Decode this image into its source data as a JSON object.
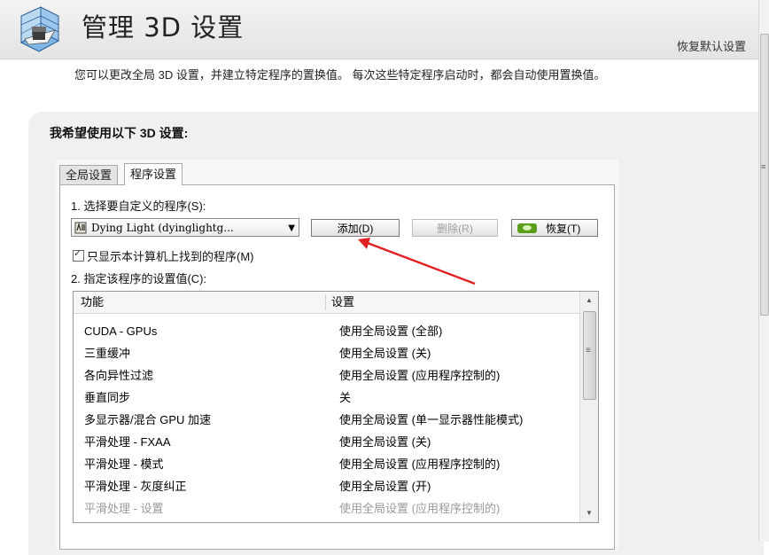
{
  "header": {
    "title": "管理 3D 设置",
    "restore_defaults": "恢复默认设置",
    "app_icon": "nvidia-3d-settings-icon"
  },
  "description": "您可以更改全局 3D 设置，并建立特定程序的置换值。 每次这些特定程序启动时，都会自动使用置换值。",
  "section_title": "我希望使用以下 3D 设置:",
  "tabs": [
    {
      "label": "全局设置",
      "active": false
    },
    {
      "label": "程序设置",
      "active": true
    }
  ],
  "program_settings": {
    "step1_label": "1. 选择要自定义的程序(S):",
    "selected_program": "Dying Light (dyinglightg...",
    "buttons": {
      "add": "添加(D)",
      "remove": "删除(R)",
      "restore": "恢复(T)"
    },
    "show_only_found": "只显示本计算机上找到的程序(M)",
    "show_only_found_checked": true,
    "step2_label": "2. 指定该程序的设置值(C):",
    "columns": [
      "功能",
      "设置"
    ],
    "rows": [
      {
        "feature": "CUDA - GPUs",
        "setting": "使用全局设置 (全部)"
      },
      {
        "feature": "三重缓冲",
        "setting": "使用全局设置 (关)"
      },
      {
        "feature": "各向异性过滤",
        "setting": "使用全局设置 (应用程序控制的)"
      },
      {
        "feature": "垂直同步",
        "setting": "关"
      },
      {
        "feature": "多显示器/混合 GPU 加速",
        "setting": "使用全局设置 (单一显示器性能模式)"
      },
      {
        "feature": "平滑处理 - FXAA",
        "setting": "使用全局设置 (关)"
      },
      {
        "feature": "平滑处理 - 模式",
        "setting": "使用全局设置 (应用程序控制的)"
      },
      {
        "feature": "平滑处理 - 灰度纠正",
        "setting": "使用全局设置 (开)"
      },
      {
        "feature": "平滑处理 - 设置",
        "setting": "使用全局设置 (应用程序控制的)"
      }
    ]
  },
  "colors": {
    "annotation_arrow": "#e02020",
    "nvidia_green": "#5a9e1a"
  }
}
